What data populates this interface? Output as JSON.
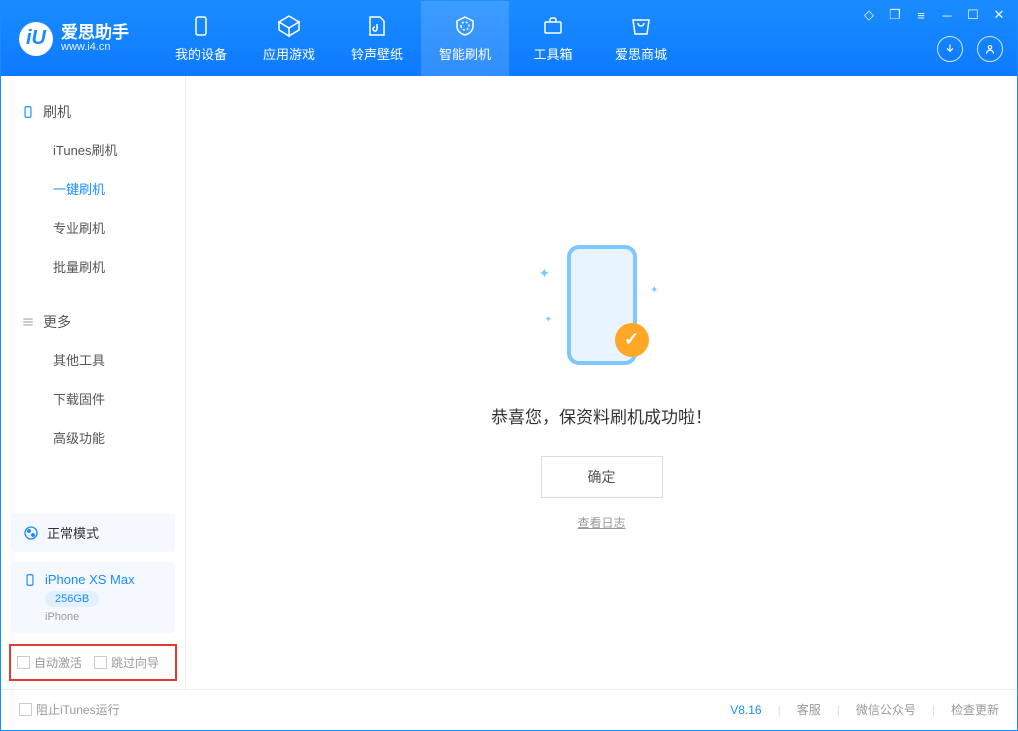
{
  "app": {
    "title": "爱思助手",
    "subtitle": "www.i4.cn"
  },
  "nav": {
    "device": "我的设备",
    "apps": "应用游戏",
    "ringtone": "铃声壁纸",
    "flash": "智能刷机",
    "toolbox": "工具箱",
    "store": "爱思商城"
  },
  "sidebar": {
    "group1": {
      "title": "刷机",
      "items": [
        "iTunes刷机",
        "一键刷机",
        "专业刷机",
        "批量刷机"
      ]
    },
    "group2": {
      "title": "更多",
      "items": [
        "其他工具",
        "下载固件",
        "高级功能"
      ]
    },
    "mode": "正常模式",
    "device": {
      "name": "iPhone XS Max",
      "storage": "256GB",
      "type": "iPhone"
    },
    "options": {
      "auto_activate": "自动激活",
      "skip_guide": "跳过向导"
    }
  },
  "main": {
    "success_msg": "恭喜您，保资料刷机成功啦！",
    "confirm": "确定",
    "view_log": "查看日志"
  },
  "footer": {
    "block_itunes": "阻止iTunes运行",
    "version": "V8.16",
    "support": "客服",
    "wechat": "微信公众号",
    "update": "检查更新"
  }
}
